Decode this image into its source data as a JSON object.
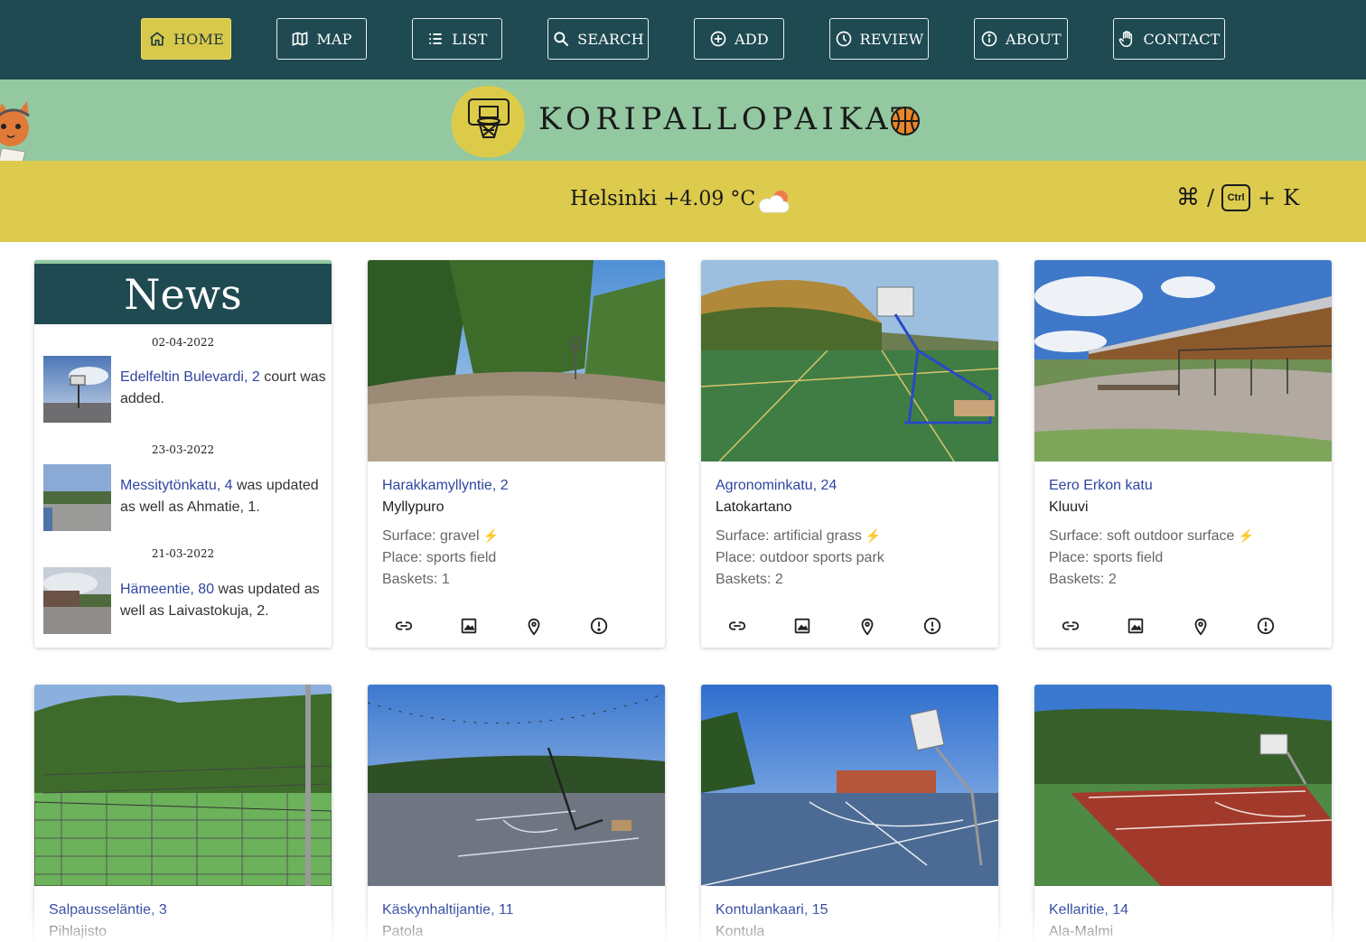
{
  "nav": {
    "items": [
      {
        "label": "HOME",
        "icon": "home-icon",
        "active": true
      },
      {
        "label": "MAP",
        "icon": "map-icon",
        "active": false
      },
      {
        "label": "LIST",
        "icon": "list-icon",
        "active": false
      },
      {
        "label": "SEARCH",
        "icon": "search-icon",
        "active": false
      },
      {
        "label": "ADD",
        "icon": "plus-circle-icon",
        "active": false
      },
      {
        "label": "REVIEW",
        "icon": "clock-icon",
        "active": false
      },
      {
        "label": "ABOUT",
        "icon": "info-icon",
        "active": false
      },
      {
        "label": "CONTACT",
        "icon": "hand-icon",
        "active": false
      }
    ],
    "bg_color": "#1f4a52",
    "active_color": "#d9c94a"
  },
  "brand": {
    "title": "KORIPALLOPAIKAT",
    "logo_icon": "basketball-hoop-icon",
    "ball_icon": "basketball-icon",
    "banner_color": "#93c8a0"
  },
  "weather": {
    "city": "Helsinki",
    "temperature": "+4.09 °C",
    "icon": "partly-cloudy-icon",
    "bar_color": "#dccb4d"
  },
  "shortcut": {
    "cmd_symbol": "⌘",
    "separator": "/",
    "ctrl_label": "Ctrl",
    "plus": "+",
    "key": "K"
  },
  "news": {
    "title": "News",
    "items": [
      {
        "date": "02-04-2022",
        "link": "Edelfeltin Bulevardi, 2",
        "rest": " court was added."
      },
      {
        "date": "23-03-2022",
        "link": "Messitytönkatu, 4",
        "rest": " was updated as well as Ahmatie, 1."
      },
      {
        "date": "21-03-2022",
        "link": "Hämeentie, 80",
        "rest": " was updated as well as Laivastokuja, 2."
      }
    ]
  },
  "labels": {
    "surface": "Surface: ",
    "place": "Place: ",
    "baskets": "Baskets: ",
    "bolt": "⚡"
  },
  "courts": [
    {
      "name": "Harakkamyllyntie, 2",
      "district": "Myllypuro",
      "surface": "gravel",
      "place": "sports field",
      "baskets": "1"
    },
    {
      "name": "Agronominkatu, 24",
      "district": "Latokartano",
      "surface": "artificial grass",
      "place": "outdoor sports park",
      "baskets": "2"
    },
    {
      "name": "Eero Erkon katu",
      "district": "Kluuvi",
      "surface": "soft outdoor surface",
      "place": "sports field",
      "baskets": "2"
    },
    {
      "name": "Salpausseläntie, 3",
      "district": "Pihlajisto"
    },
    {
      "name": "Käskynhaltijantie, 11",
      "district": "Patola"
    },
    {
      "name": "Kontulankaari, 15",
      "district": "Kontula"
    },
    {
      "name": "Kellaritie, 14",
      "district": "Ala-Malmi"
    }
  ],
  "card_actions": [
    "link-icon",
    "image-icon",
    "location-pin-icon",
    "alert-icon"
  ]
}
